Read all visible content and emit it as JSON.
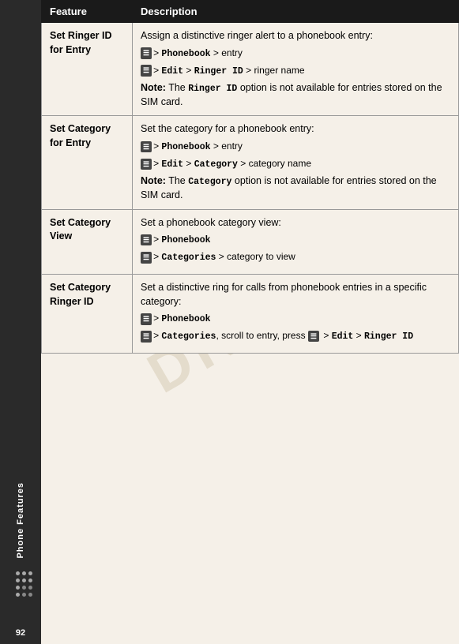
{
  "page": {
    "number": "92",
    "watermark": "DRAFT",
    "sidebar_label": "Phone Features"
  },
  "table": {
    "headers": [
      "Feature",
      "Description"
    ],
    "rows": [
      {
        "feature": "Set Ringer ID for Entry",
        "description_parts": [
          {
            "type": "text",
            "content": "Assign a distinctive ringer alert to a phonebook entry:"
          },
          {
            "type": "step",
            "icon": true,
            "parts": [
              " > ",
              {
                "bold": "Phonebook"
              },
              " > entry"
            ]
          },
          {
            "type": "step",
            "icon": true,
            "parts": [
              " > ",
              {
                "bold": "Edit"
              },
              " > ",
              {
                "bold": "Ringer ID"
              },
              " > ringer name"
            ]
          },
          {
            "type": "note",
            "content": "The ",
            "keyword": "Ringer ID",
            "after": " option is not available for entries stored on the SIM card."
          }
        ]
      },
      {
        "feature": "Set Category for Entry",
        "description_parts": [
          {
            "type": "text",
            "content": "Set the category for a phonebook entry:"
          },
          {
            "type": "step",
            "icon": true,
            "parts": [
              " > ",
              {
                "bold": "Phonebook"
              },
              " > entry"
            ]
          },
          {
            "type": "step",
            "icon": true,
            "parts": [
              " > ",
              {
                "bold": "Edit"
              },
              " > ",
              {
                "bold": "Category"
              },
              " > category name"
            ]
          },
          {
            "type": "note",
            "content": "The ",
            "keyword": "Category",
            "after": " option is not available for entries stored on the SIM card."
          }
        ]
      },
      {
        "feature": "Set Category View",
        "description_parts": [
          {
            "type": "text",
            "content": "Set a phonebook category view:"
          },
          {
            "type": "step",
            "icon": true,
            "parts": [
              " > ",
              {
                "bold": "Phonebook"
              }
            ]
          },
          {
            "type": "step",
            "icon": true,
            "parts": [
              " > ",
              {
                "bold": "Categories"
              },
              " > category to view"
            ]
          }
        ]
      },
      {
        "feature": "Set Category Ringer ID",
        "description_parts": [
          {
            "type": "text",
            "content": "Set a distinctive ring for calls from phonebook entries in a specific category:"
          },
          {
            "type": "step",
            "icon": true,
            "parts": [
              " > ",
              {
                "bold": "Phonebook"
              }
            ]
          },
          {
            "type": "step",
            "icon": true,
            "parts": [
              " > ",
              {
                "bold": "Categories"
              },
              ", scroll to entry, press "
            ]
          },
          {
            "type": "inline_step",
            "content": " > Edit > Ringer ID",
            "icon": true
          }
        ]
      }
    ]
  }
}
